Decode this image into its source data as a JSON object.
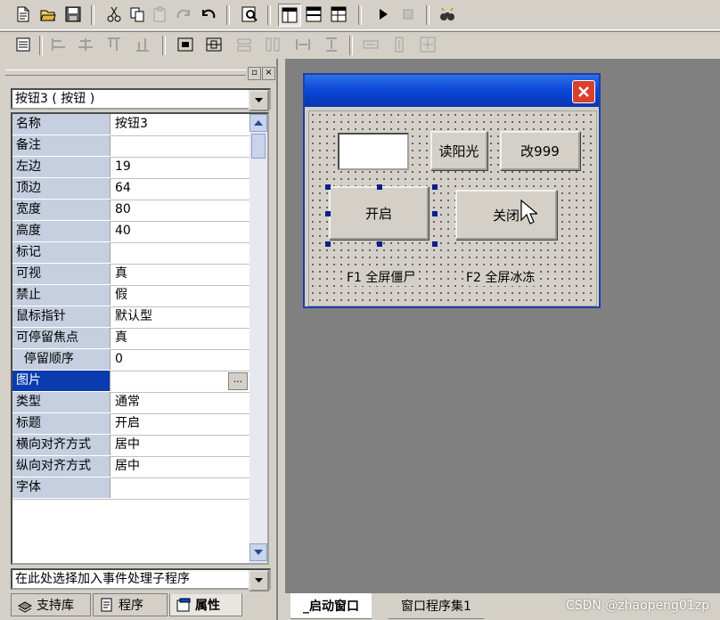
{
  "toolbar1": {
    "buttons": [
      "new-file-icon",
      "open-folder-icon",
      "save-icon",
      "cut-icon",
      "copy-icon",
      "paste-icon",
      "redo-icon",
      "undo-icon",
      "find-icon",
      "layout-1-icon",
      "layout-2-icon",
      "layout-3-icon",
      "run-icon",
      "stop-icon",
      "binoculars-icon"
    ]
  },
  "property_panel": {
    "object_combo": "按钮3 ( 按钮 )",
    "event_combo": "在此处选择加入事件处理子程序",
    "rows": [
      {
        "name": "名称",
        "value": "按钮3"
      },
      {
        "name": "备注",
        "value": ""
      },
      {
        "name": "左边",
        "value": "19"
      },
      {
        "name": "顶边",
        "value": "64"
      },
      {
        "name": "宽度",
        "value": "80"
      },
      {
        "name": "高度",
        "value": "40"
      },
      {
        "name": "标记",
        "value": ""
      },
      {
        "name": "可视",
        "value": "真"
      },
      {
        "name": "禁止",
        "value": "假"
      },
      {
        "name": "鼠标指针",
        "value": "默认型"
      },
      {
        "name": "可停留焦点",
        "value": "真"
      },
      {
        "name": "  停留顺序",
        "value": "0"
      },
      {
        "name": "图片",
        "value": ""
      },
      {
        "name": "类型",
        "value": "通常"
      },
      {
        "name": "标题",
        "value": "开启"
      },
      {
        "name": "横向对齐方式",
        "value": "居中"
      },
      {
        "name": "纵向对齐方式",
        "value": "居中"
      },
      {
        "name": "字体",
        "value": ""
      }
    ],
    "ellipsis": "...",
    "tabs": [
      {
        "label": "支持库",
        "icon": "library-icon"
      },
      {
        "label": "程序",
        "icon": "program-icon"
      },
      {
        "label": "属性",
        "icon": "properties-icon"
      }
    ]
  },
  "form_designer": {
    "buttons": {
      "read_sunlight": "读阳光",
      "change_999": "改999",
      "open": "开启",
      "close": "关闭"
    },
    "labels": {
      "f1": "F1  全屏僵尸",
      "f2": "F2  全屏冰冻"
    }
  },
  "doc_tabs": [
    "_启动窗口",
    "窗口程序集1"
  ],
  "watermark": "CSDN @zhaopeng01zp"
}
